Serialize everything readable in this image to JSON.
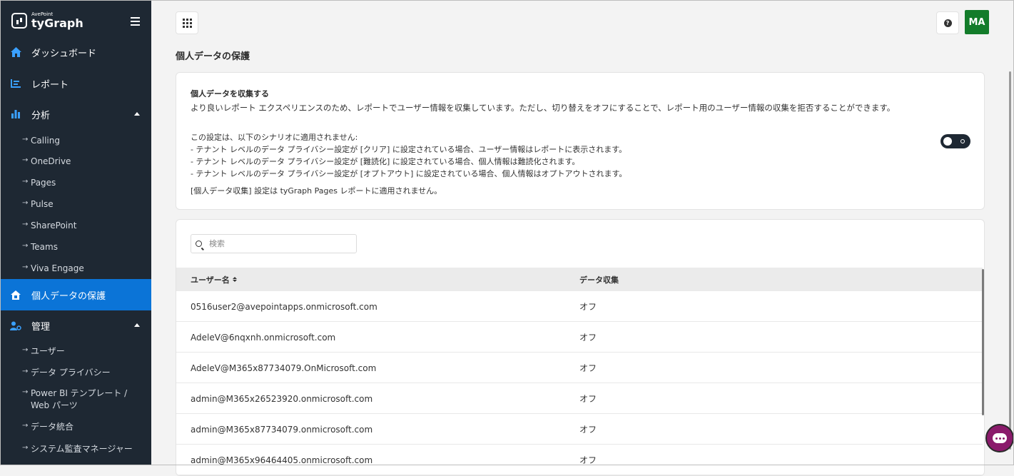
{
  "brand": {
    "small": "AvePoint",
    "name": "tyGraph"
  },
  "sidebar": {
    "dashboard": "ダッシュボード",
    "reports": "レポート",
    "analysis": "分析",
    "analysis_items": [
      "Calling",
      "OneDrive",
      "Pages",
      "Pulse",
      "SharePoint",
      "Teams",
      "Viva Engage"
    ],
    "privacy": "個人データの保護",
    "admin": "管理",
    "admin_items": [
      "ユーザー",
      "データ プライバシー",
      "Power BI テンプレート /",
      "Web パーツ",
      "データ統合",
      "システム監査マネージャー"
    ]
  },
  "topbar": {
    "help_glyph": "?",
    "avatar": "MA"
  },
  "page": {
    "title": "個人データの保護"
  },
  "settings": {
    "title": "個人データを収集する",
    "description": "より良いレポート エクスペリエンスのため、レポートでユーザー情報を収集しています。ただし、切り替えをオフにすることで、レポート用のユーザー情報の収集を拒否することができます。",
    "lines": [
      "この設定は、以下のシナリオに適用されません:",
      "- テナント レベルのデータ プライバシー設定が [クリア] に設定されている場合、ユーザー情報はレポートに表示されます。",
      "- テナント レベルのデータ プライバシー設定が [難読化] に設定されている場合、個人情報は難読化されます。",
      "- テナント レベルのデータ プライバシー設定が [オプトアウト] に設定されている場合、個人情報はオプトアウトされます。"
    ],
    "note": "[個人データ収集] 設定は tyGraph Pages レポートに適用されません。",
    "toggle_on": false
  },
  "table": {
    "search_placeholder": "検索",
    "col_user": "ユーザー名",
    "col_collection": "データ収集",
    "rows": [
      {
        "user": "0516user2@avepointapps.onmicrosoft.com",
        "value": "オフ"
      },
      {
        "user": "AdeleV@6nqxnh.onmicrosoft.com",
        "value": "オフ"
      },
      {
        "user": "AdeleV@M365x87734079.OnMicrosoft.com",
        "value": "オフ"
      },
      {
        "user": "admin@M365x26523920.onmicrosoft.com",
        "value": "オフ"
      },
      {
        "user": "admin@M365x87734079.onmicrosoft.com",
        "value": "オフ"
      },
      {
        "user": "admin@M365x96464405.onmicrosoft.com",
        "value": "オフ"
      }
    ]
  },
  "colors": {
    "sidebar": "#1e2833",
    "accent": "#0b74d7",
    "avatar": "#137c2a",
    "chat": "#8a1a6b"
  }
}
